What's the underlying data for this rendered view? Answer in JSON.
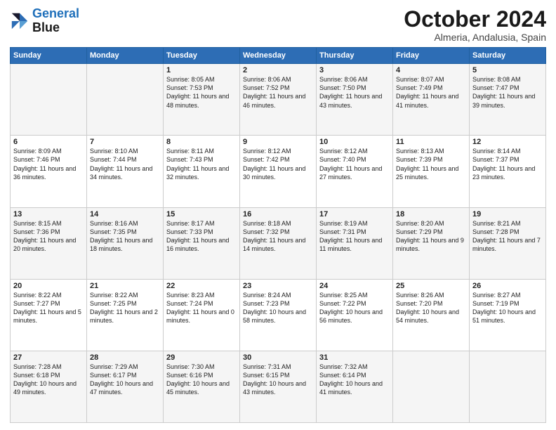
{
  "logo": {
    "line1": "General",
    "line2": "Blue"
  },
  "title": "October 2024",
  "subtitle": "Almeria, Andalusia, Spain",
  "days_of_week": [
    "Sunday",
    "Monday",
    "Tuesday",
    "Wednesday",
    "Thursday",
    "Friday",
    "Saturday"
  ],
  "weeks": [
    [
      {
        "day": "",
        "sunrise": "",
        "sunset": "",
        "daylight": ""
      },
      {
        "day": "",
        "sunrise": "",
        "sunset": "",
        "daylight": ""
      },
      {
        "day": "1",
        "sunrise": "Sunrise: 8:05 AM",
        "sunset": "Sunset: 7:53 PM",
        "daylight": "Daylight: 11 hours and 48 minutes."
      },
      {
        "day": "2",
        "sunrise": "Sunrise: 8:06 AM",
        "sunset": "Sunset: 7:52 PM",
        "daylight": "Daylight: 11 hours and 46 minutes."
      },
      {
        "day": "3",
        "sunrise": "Sunrise: 8:06 AM",
        "sunset": "Sunset: 7:50 PM",
        "daylight": "Daylight: 11 hours and 43 minutes."
      },
      {
        "day": "4",
        "sunrise": "Sunrise: 8:07 AM",
        "sunset": "Sunset: 7:49 PM",
        "daylight": "Daylight: 11 hours and 41 minutes."
      },
      {
        "day": "5",
        "sunrise": "Sunrise: 8:08 AM",
        "sunset": "Sunset: 7:47 PM",
        "daylight": "Daylight: 11 hours and 39 minutes."
      }
    ],
    [
      {
        "day": "6",
        "sunrise": "Sunrise: 8:09 AM",
        "sunset": "Sunset: 7:46 PM",
        "daylight": "Daylight: 11 hours and 36 minutes."
      },
      {
        "day": "7",
        "sunrise": "Sunrise: 8:10 AM",
        "sunset": "Sunset: 7:44 PM",
        "daylight": "Daylight: 11 hours and 34 minutes."
      },
      {
        "day": "8",
        "sunrise": "Sunrise: 8:11 AM",
        "sunset": "Sunset: 7:43 PM",
        "daylight": "Daylight: 11 hours and 32 minutes."
      },
      {
        "day": "9",
        "sunrise": "Sunrise: 8:12 AM",
        "sunset": "Sunset: 7:42 PM",
        "daylight": "Daylight: 11 hours and 30 minutes."
      },
      {
        "day": "10",
        "sunrise": "Sunrise: 8:12 AM",
        "sunset": "Sunset: 7:40 PM",
        "daylight": "Daylight: 11 hours and 27 minutes."
      },
      {
        "day": "11",
        "sunrise": "Sunrise: 8:13 AM",
        "sunset": "Sunset: 7:39 PM",
        "daylight": "Daylight: 11 hours and 25 minutes."
      },
      {
        "day": "12",
        "sunrise": "Sunrise: 8:14 AM",
        "sunset": "Sunset: 7:37 PM",
        "daylight": "Daylight: 11 hours and 23 minutes."
      }
    ],
    [
      {
        "day": "13",
        "sunrise": "Sunrise: 8:15 AM",
        "sunset": "Sunset: 7:36 PM",
        "daylight": "Daylight: 11 hours and 20 minutes."
      },
      {
        "day": "14",
        "sunrise": "Sunrise: 8:16 AM",
        "sunset": "Sunset: 7:35 PM",
        "daylight": "Daylight: 11 hours and 18 minutes."
      },
      {
        "day": "15",
        "sunrise": "Sunrise: 8:17 AM",
        "sunset": "Sunset: 7:33 PM",
        "daylight": "Daylight: 11 hours and 16 minutes."
      },
      {
        "day": "16",
        "sunrise": "Sunrise: 8:18 AM",
        "sunset": "Sunset: 7:32 PM",
        "daylight": "Daylight: 11 hours and 14 minutes."
      },
      {
        "day": "17",
        "sunrise": "Sunrise: 8:19 AM",
        "sunset": "Sunset: 7:31 PM",
        "daylight": "Daylight: 11 hours and 11 minutes."
      },
      {
        "day": "18",
        "sunrise": "Sunrise: 8:20 AM",
        "sunset": "Sunset: 7:29 PM",
        "daylight": "Daylight: 11 hours and 9 minutes."
      },
      {
        "day": "19",
        "sunrise": "Sunrise: 8:21 AM",
        "sunset": "Sunset: 7:28 PM",
        "daylight": "Daylight: 11 hours and 7 minutes."
      }
    ],
    [
      {
        "day": "20",
        "sunrise": "Sunrise: 8:22 AM",
        "sunset": "Sunset: 7:27 PM",
        "daylight": "Daylight: 11 hours and 5 minutes."
      },
      {
        "day": "21",
        "sunrise": "Sunrise: 8:22 AM",
        "sunset": "Sunset: 7:25 PM",
        "daylight": "Daylight: 11 hours and 2 minutes."
      },
      {
        "day": "22",
        "sunrise": "Sunrise: 8:23 AM",
        "sunset": "Sunset: 7:24 PM",
        "daylight": "Daylight: 11 hours and 0 minutes."
      },
      {
        "day": "23",
        "sunrise": "Sunrise: 8:24 AM",
        "sunset": "Sunset: 7:23 PM",
        "daylight": "Daylight: 10 hours and 58 minutes."
      },
      {
        "day": "24",
        "sunrise": "Sunrise: 8:25 AM",
        "sunset": "Sunset: 7:22 PM",
        "daylight": "Daylight: 10 hours and 56 minutes."
      },
      {
        "day": "25",
        "sunrise": "Sunrise: 8:26 AM",
        "sunset": "Sunset: 7:20 PM",
        "daylight": "Daylight: 10 hours and 54 minutes."
      },
      {
        "day": "26",
        "sunrise": "Sunrise: 8:27 AM",
        "sunset": "Sunset: 7:19 PM",
        "daylight": "Daylight: 10 hours and 51 minutes."
      }
    ],
    [
      {
        "day": "27",
        "sunrise": "Sunrise: 7:28 AM",
        "sunset": "Sunset: 6:18 PM",
        "daylight": "Daylight: 10 hours and 49 minutes."
      },
      {
        "day": "28",
        "sunrise": "Sunrise: 7:29 AM",
        "sunset": "Sunset: 6:17 PM",
        "daylight": "Daylight: 10 hours and 47 minutes."
      },
      {
        "day": "29",
        "sunrise": "Sunrise: 7:30 AM",
        "sunset": "Sunset: 6:16 PM",
        "daylight": "Daylight: 10 hours and 45 minutes."
      },
      {
        "day": "30",
        "sunrise": "Sunrise: 7:31 AM",
        "sunset": "Sunset: 6:15 PM",
        "daylight": "Daylight: 10 hours and 43 minutes."
      },
      {
        "day": "31",
        "sunrise": "Sunrise: 7:32 AM",
        "sunset": "Sunset: 6:14 PM",
        "daylight": "Daylight: 10 hours and 41 minutes."
      },
      {
        "day": "",
        "sunrise": "",
        "sunset": "",
        "daylight": ""
      },
      {
        "day": "",
        "sunrise": "",
        "sunset": "",
        "daylight": ""
      }
    ]
  ]
}
